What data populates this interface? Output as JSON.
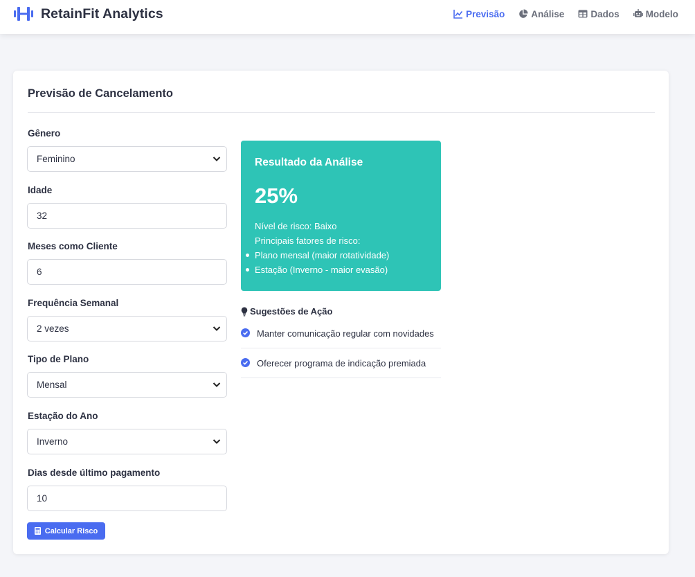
{
  "app": {
    "title": "RetainFit Analytics"
  },
  "nav": {
    "items": [
      {
        "label": "Previsão",
        "icon": "line-chart-icon",
        "active": true
      },
      {
        "label": "Análise",
        "icon": "pie-chart-icon",
        "active": false
      },
      {
        "label": "Dados",
        "icon": "table-icon",
        "active": false
      },
      {
        "label": "Modelo",
        "icon": "robot-icon",
        "active": false
      }
    ]
  },
  "form": {
    "title": "Previsão de Cancelamento",
    "fields": [
      {
        "label": "Gênero",
        "value": "Feminino",
        "type": "select"
      },
      {
        "label": "Idade",
        "value": "32",
        "type": "input"
      },
      {
        "label": "Meses como Cliente",
        "value": "6",
        "type": "input"
      },
      {
        "label": "Frequência Semanal",
        "value": "2 vezes",
        "type": "select"
      },
      {
        "label": "Tipo de Plano",
        "value": "Mensal",
        "type": "select"
      },
      {
        "label": "Estação do Ano",
        "value": "Inverno",
        "type": "select"
      },
      {
        "label": "Dias desde último pagamento",
        "value": "10",
        "type": "input"
      }
    ],
    "submit_label": "Calcular Risco"
  },
  "result": {
    "title": "Resultado da Análise",
    "percent": "25%",
    "risk_level": "Nível de risco: Baixo",
    "factors_heading": "Principais fatores de risco:",
    "factors": [
      "Plano mensal (maior rotatividade)",
      "Estação (Inverno - maior evasão)"
    ],
    "color": "#2ec4b6"
  },
  "suggestions": {
    "title": "Sugestões de Ação",
    "items": [
      "Manter comunicação regular com novidades",
      "Oferecer programa de indicação premiada"
    ]
  },
  "colors": {
    "accent": "#4a6cf0",
    "result_bg": "#2ec4b6"
  }
}
